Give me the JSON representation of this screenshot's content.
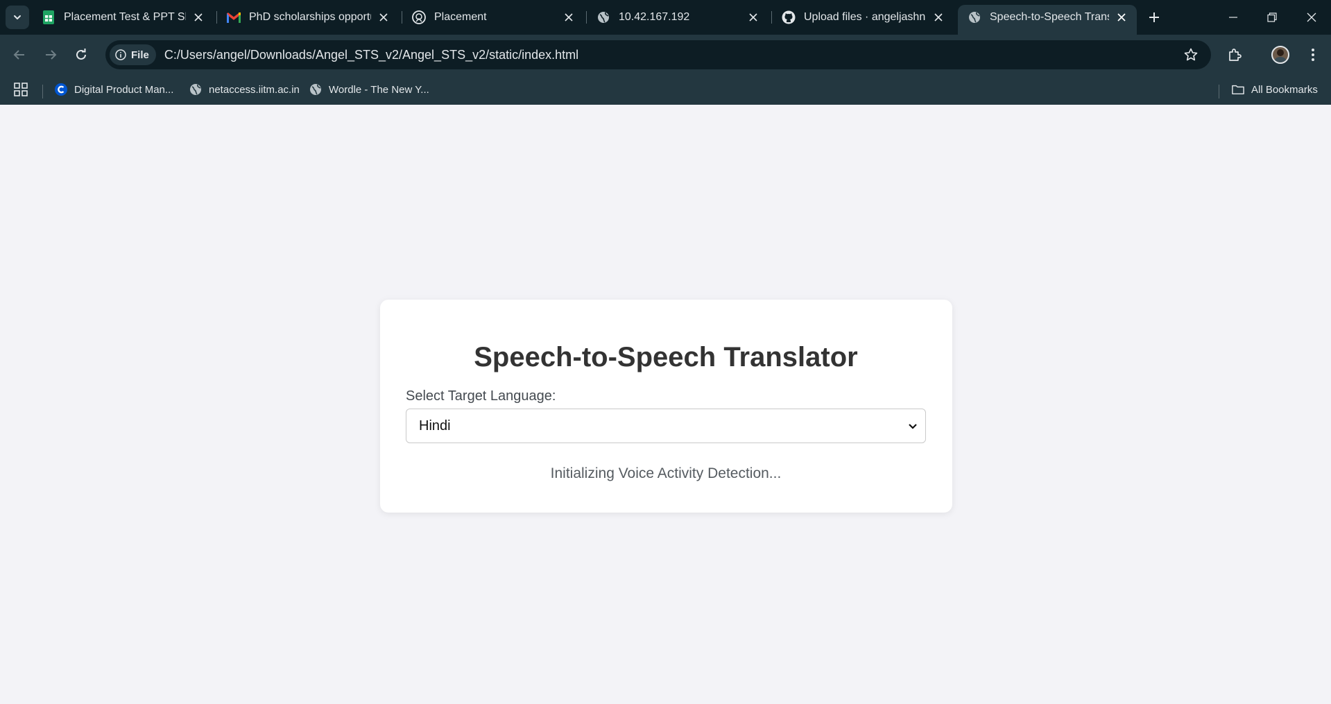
{
  "browser": {
    "tabs": [
      {
        "label": "Placement Test & PPT Slot",
        "icon": "google-sheets-icon"
      },
      {
        "label": "PhD scholarships opportun",
        "icon": "gmail-icon"
      },
      {
        "label": "Placement",
        "icon": "placement-site-icon"
      },
      {
        "label": "10.42.167.192",
        "icon": "globe-icon"
      },
      {
        "label": "Upload files · angeljashnan",
        "icon": "github-icon"
      },
      {
        "label": "Speech-to-Speech Translat",
        "icon": "globe-icon"
      }
    ],
    "address": {
      "chip_label": "File",
      "url": "C:/Users/angel/Downloads/Angel_STS_v2/Angel_STS_v2/static/index.html"
    },
    "bookmarks": [
      {
        "label": "Digital Product Man...",
        "icon": "c-logo-icon"
      },
      {
        "label": "netaccess.iitm.ac.in",
        "icon": "globe-icon"
      },
      {
        "label": "Wordle - The New Y...",
        "icon": "globe-icon"
      }
    ],
    "all_bookmarks_label": "All Bookmarks",
    "colors": {
      "tabstrip": "#0d1d24",
      "toolbar": "#233740",
      "page_bg": "#f3f3f7"
    }
  },
  "app": {
    "title": "Speech-to-Speech Translator",
    "language_label": "Select Target Language:",
    "language_selected": "Hindi",
    "status": "Initializing Voice Activity Detection..."
  }
}
